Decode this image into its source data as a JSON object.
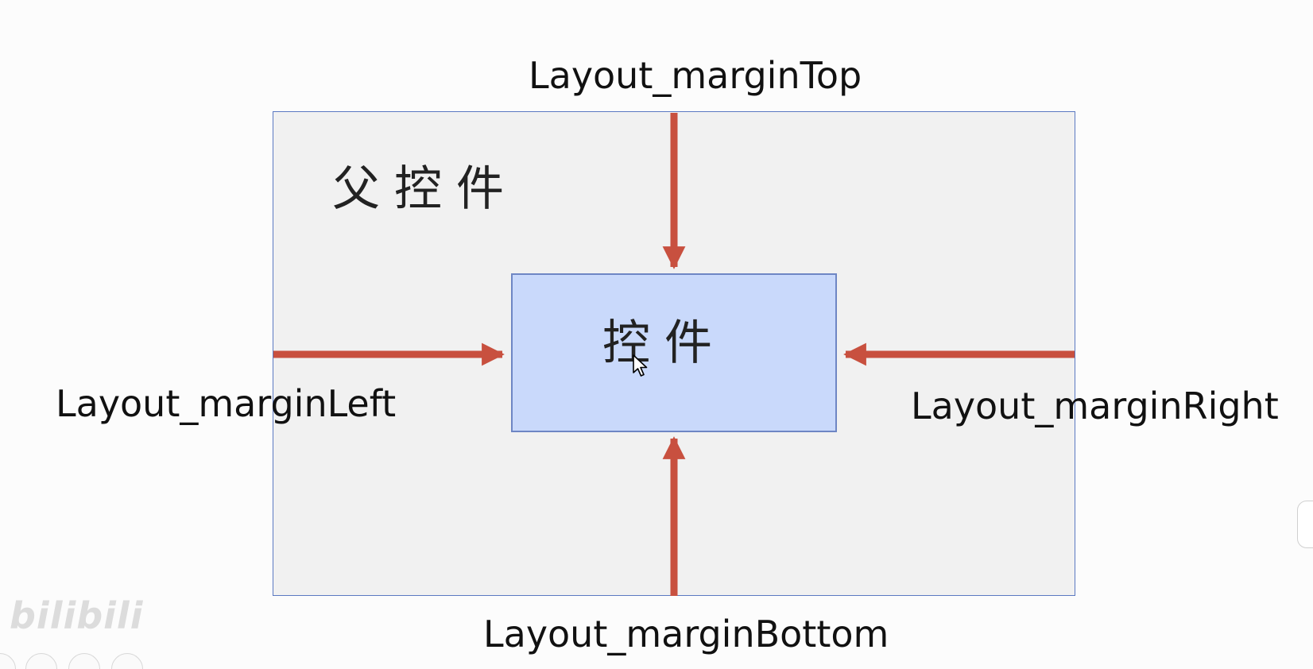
{
  "diagram": {
    "parent_label": "父控件",
    "child_label": "控件",
    "margin_top_label": "Layout_marginTop",
    "margin_left_label": "Layout_marginLeft",
    "margin_right_label": "Layout_marginRight",
    "margin_bottom_label": "Layout_marginBottom"
  },
  "colors": {
    "parent_fill": "#f1f1f1",
    "parent_border": "#5b79c2",
    "child_fill": "#c9d9fb",
    "child_border": "#6e86c4",
    "arrow": "#c8503f"
  },
  "icons": {
    "cursor": "mouse-pointer-icon",
    "watermark": "bilibili-logo"
  },
  "watermark": {
    "text": "bilibili"
  }
}
